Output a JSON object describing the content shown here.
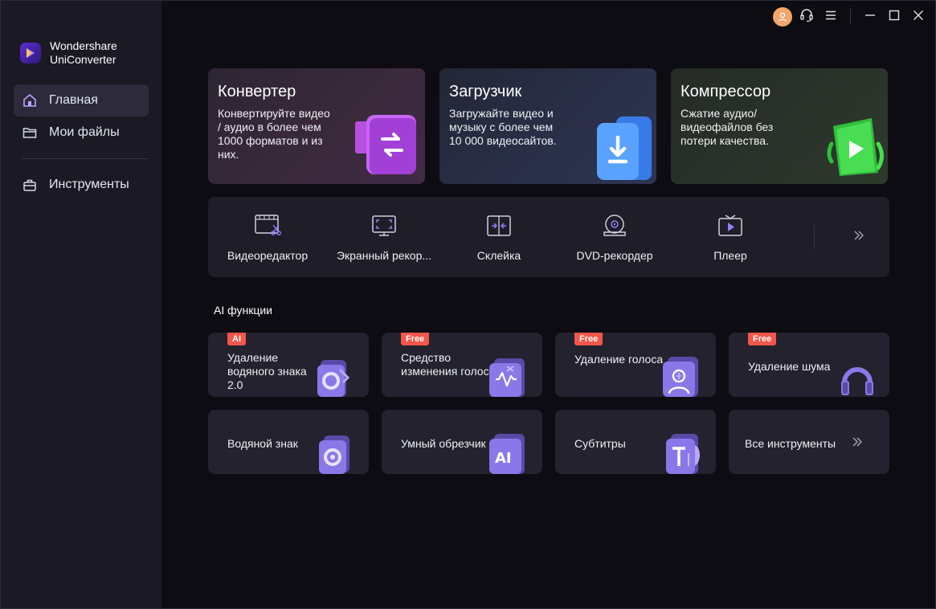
{
  "app": {
    "brand_line1": "Wondershare",
    "brand_line2": "UniConverter"
  },
  "sidebar": {
    "items": [
      {
        "label": "Главная",
        "icon": "home-icon",
        "active": true
      },
      {
        "label": "Мои файлы",
        "icon": "folder-icon",
        "active": false
      },
      {
        "label": "Инструменты",
        "icon": "toolbox-icon",
        "active": false
      }
    ]
  },
  "titlebar": {
    "icons": [
      "user-avatar-icon",
      "headset-icon",
      "menu-icon",
      "minimize-icon",
      "maximize-icon",
      "close-icon"
    ],
    "avatar_color": "#f3a56a"
  },
  "hero_cards": [
    {
      "title": "Конвертер",
      "desc": "Конвертируйте видео / аудио в более чем 1000 форматов и из них.",
      "icon": "converter-icon",
      "accent": "#c04be8"
    },
    {
      "title": "Загрузчик",
      "desc": "Загружайте видео и музыку с более чем 10 000 видеосайтов.",
      "icon": "download-icon",
      "accent": "#3b8cf5"
    },
    {
      "title": "Компрессор",
      "desc": "Сжатие аудио/ видеофайлов без потери качества.",
      "icon": "compress-icon",
      "accent": "#3fd14a"
    }
  ],
  "tools": [
    {
      "label": "Видеоредактор",
      "icon": "video-editor-icon"
    },
    {
      "label": "Экранный рекор...",
      "icon": "screen-recorder-icon"
    },
    {
      "label": "Склейка",
      "icon": "merge-icon"
    },
    {
      "label": "DVD-рекордер",
      "icon": "dvd-icon"
    },
    {
      "label": "Плеер",
      "icon": "player-icon"
    }
  ],
  "ai_section": {
    "title": "AI функции",
    "cards": [
      {
        "title": "Удаление водяного знака 2.0",
        "badge": "AI",
        "icon": "watermark-remove-icon"
      },
      {
        "title": "Средство изменения голоса",
        "badge": "Free",
        "icon": "voice-changer-icon"
      },
      {
        "title": "Удаление голоса",
        "badge": "Free",
        "icon": "vocal-remover-icon"
      },
      {
        "title": "Удаление шума",
        "badge": "Free",
        "icon": "noise-remover-icon"
      },
      {
        "title": "Водяной знак",
        "badge": "",
        "icon": "watermark-icon"
      },
      {
        "title": "Умный обрезчик",
        "badge": "",
        "icon": "smart-trimmer-icon"
      },
      {
        "title": "Субтитры",
        "badge": "",
        "icon": "subtitles-icon"
      },
      {
        "title": "Все инструменты",
        "badge": "",
        "icon": "chevron-double-right-icon"
      }
    ]
  },
  "colors": {
    "badge": "#f3564a",
    "sidebar_bg": "#1b1a24",
    "card_bg": "#23222e"
  }
}
